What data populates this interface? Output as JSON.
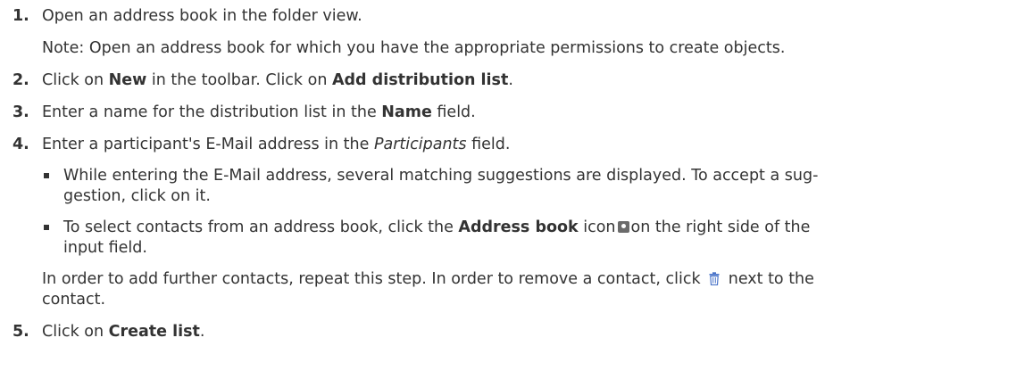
{
  "steps": [
    {
      "number": "1.",
      "text": "Open an address book in the folder view.",
      "note": "Note: Open an address book for which you have the appropriate permissions to create objects."
    },
    {
      "number": "2.",
      "a": "Click on ",
      "b": "New",
      "c": " in the toolbar. Click on ",
      "d": "Add distribution list",
      "e": "."
    },
    {
      "number": "3.",
      "a": "Enter a name for the distribution list in the ",
      "b": "Name",
      "c": " field."
    },
    {
      "number": "4.",
      "a": "Enter a participant's E-Mail address in the ",
      "b": "Participants",
      "c": " field.",
      "bullets": [
        {
          "line1": "While entering the E-Mail address, several matching suggestions are displayed. To accept a sug-",
          "line2": "gestion, click on it."
        },
        {
          "a": "To select contacts from an address book, click the ",
          "b": "Address book",
          "c": " icon",
          "d": "on the right side of the",
          "line2": "input field."
        }
      ],
      "after_line1_a": "In order to add further contacts, repeat this step. In order to remove a contact, click ",
      "after_line1_b": " next to the",
      "after_line2": "contact."
    },
    {
      "number": "5.",
      "a": "Click on ",
      "b": "Create list",
      "c": "."
    }
  ],
  "icons": {
    "address_book": "address-book-icon",
    "trash": "trash-icon"
  },
  "colors": {
    "text": "#333333",
    "icon": "#6b6b6b",
    "trash": "#4a74c9"
  }
}
